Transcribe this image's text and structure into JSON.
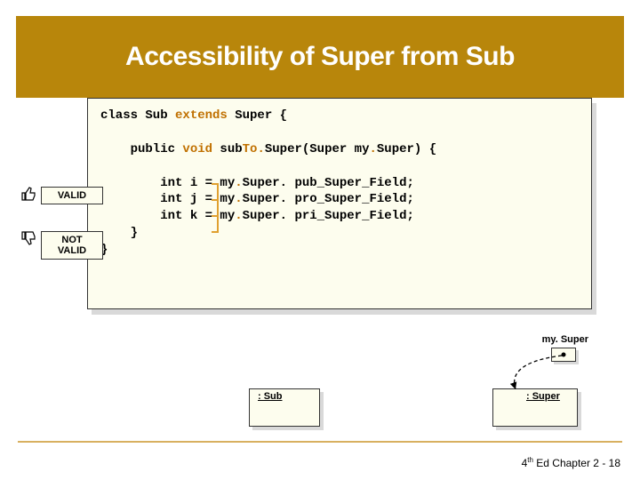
{
  "title": "Accessibility of Super from Sub",
  "code": {
    "line1a": "class Sub ",
    "line1b": "extends",
    "line1c": " Super {",
    "line2a": "    public ",
    "line2b": "void",
    "line2c": " sub",
    "line2d": "To.",
    "line2e": "Super(Super my",
    "line2f": ".",
    "line2g": "Super) {",
    "line3a": "        int i = my",
    "line3b": ".",
    "line3c": "Super. pub_Super_Field;",
    "line4a": "        int j = my",
    "line4b": ".",
    "line4c": "Super. pro_Super_Field;",
    "line5a": "        int k = my",
    "line5b": ".",
    "line5c": "Super. pri_Super_Field;",
    "line6": "    }",
    "line7": "}"
  },
  "badges": {
    "valid": "VALID",
    "notvalid": "NOT VALID"
  },
  "labels": {
    "mysuper": "my. Super",
    "sub": ": Sub",
    "super": ": Super"
  },
  "footer": {
    "prefix": "4",
    "ord": "th",
    "rest": " Ed Chapter 2 - 18"
  }
}
